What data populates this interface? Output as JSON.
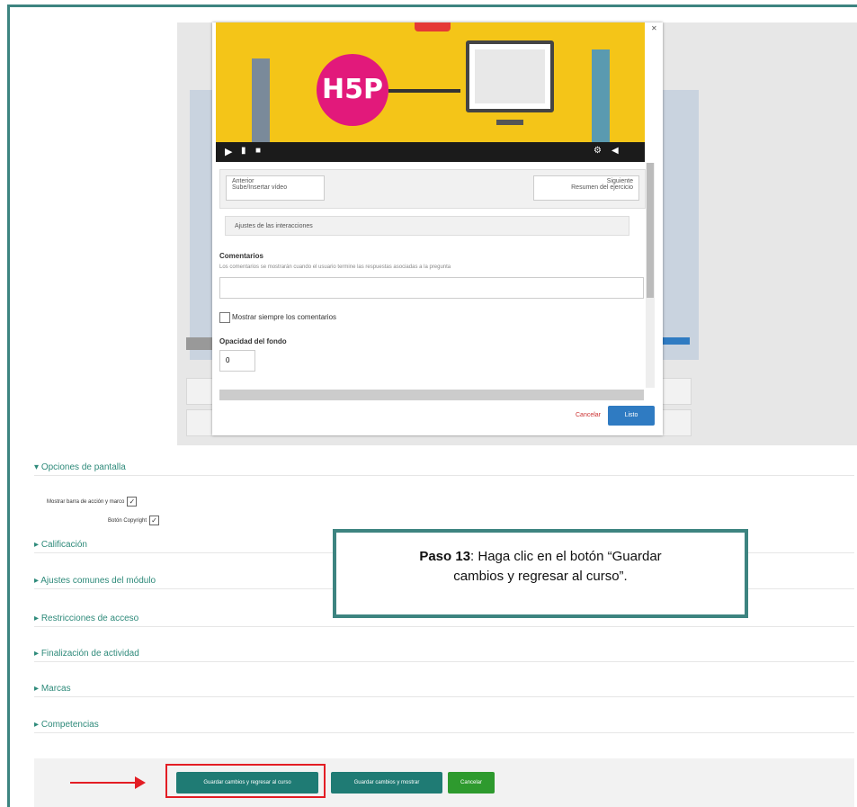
{
  "callout": {
    "step_bold": "Paso 13",
    "step_text": ": Haga clic en el botón “Guardar",
    "step_text2": "cambios y regresar al curso”."
  },
  "modal": {
    "video_logo": "H5P",
    "prev_nav": {
      "label": "Anterior",
      "title": "Sube/Insertar vídeo"
    },
    "next_nav": {
      "label": "Siguiente",
      "title": "Resumen del ejercicio"
    },
    "accordion_label": "Ajustes de las interacciones",
    "comments_label": "Comentarios",
    "comments_help": "Los comentarios se mostrarán cuando el usuario termine las respuestas asociadas a la pregunta",
    "always_show_label": "Mostrar siempre los comentarios",
    "opacity_label": "Opacidad del fondo",
    "opacity_value": "0",
    "cancel_label": "Cancelar",
    "save_label": "Listo"
  },
  "sections": [
    "Opciones de pantalla",
    "Calificación",
    "Ajustes comunes del módulo",
    "Restricciones de acceso",
    "Finalización de actividad",
    "Marcas",
    "Competencias"
  ],
  "display_options": {
    "toolbar_label": "Mostrar barra de acción y marco",
    "copyright_label": "Botón Copyright"
  },
  "footer": {
    "save_return": "Guardar cambios y regresar al curso",
    "save_show": "Guardar cambios y mostrar",
    "cancel": "Cancelar"
  },
  "colors": {
    "accent": "#3d8480",
    "highlight": "#e31d24",
    "button_teal": "#1f7b74",
    "button_green": "#2e9a2e"
  }
}
